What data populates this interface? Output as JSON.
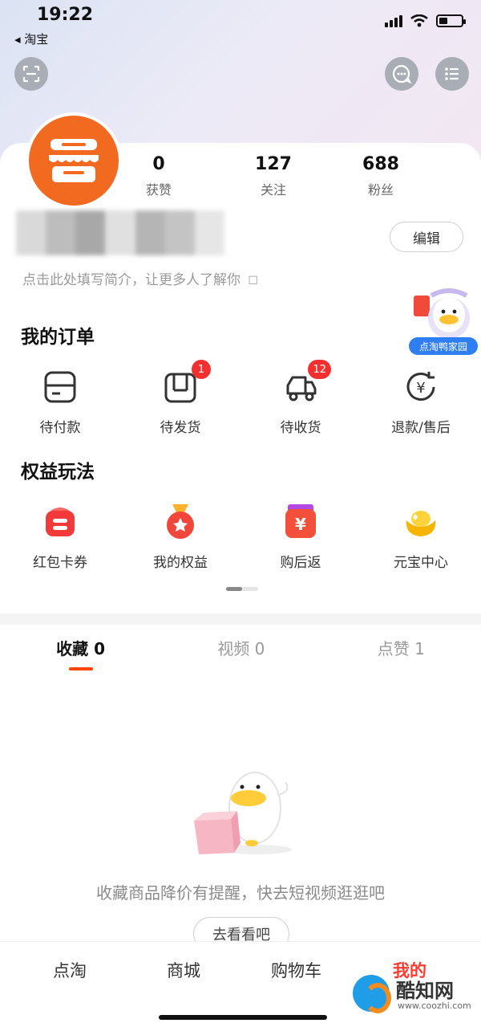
{
  "status_bar": {
    "time": "19:22",
    "back_app": "◂ 淘宝"
  },
  "profile": {
    "stats": [
      {
        "value": "0",
        "label": "获赞"
      },
      {
        "value": "127",
        "label": "关注"
      },
      {
        "value": "688",
        "label": "粉丝"
      }
    ],
    "edit_label": "编辑",
    "bio_placeholder": "点击此处填写简介，让更多人了解你",
    "bio_edit_icon": "☐"
  },
  "duck_badge": {
    "label": "点淘鸭家园"
  },
  "orders": {
    "title": "我的订单",
    "items": [
      {
        "label": "待付款",
        "icon": "wallet-icon",
        "badge": ""
      },
      {
        "label": "待发货",
        "icon": "package-icon",
        "badge": "1"
      },
      {
        "label": "待收货",
        "icon": "truck-icon",
        "badge": "12"
      },
      {
        "label": "退款/售后",
        "icon": "refund-icon",
        "badge": ""
      }
    ]
  },
  "benefits": {
    "title": "权益玩法",
    "items": [
      {
        "label": "红包卡券",
        "icon": "red-packet-icon"
      },
      {
        "label": "我的权益",
        "icon": "medal-icon"
      },
      {
        "label": "购后返",
        "icon": "cashback-icon"
      },
      {
        "label": "元宝中心",
        "icon": "ingot-icon"
      }
    ]
  },
  "content_tabs": [
    {
      "label": "收藏 0",
      "active": true
    },
    {
      "label": "视频 0",
      "active": false
    },
    {
      "label": "点赞 1",
      "active": false
    }
  ],
  "empty_state": {
    "message": "收藏商品降价有提醒，快去短视频逛逛吧",
    "button": "去看看吧"
  },
  "bottom_nav": [
    {
      "label": "点淘",
      "active": false
    },
    {
      "label": "商城",
      "active": false
    },
    {
      "label": "购物车",
      "active": false
    },
    {
      "label": "我的",
      "active": true
    }
  ],
  "watermark": {
    "title": "酷知网",
    "url": "www.coozhi.com"
  },
  "colors": {
    "accent": "#ff3a2f",
    "badge": "#f23030",
    "avatar": "#f26a1f"
  }
}
